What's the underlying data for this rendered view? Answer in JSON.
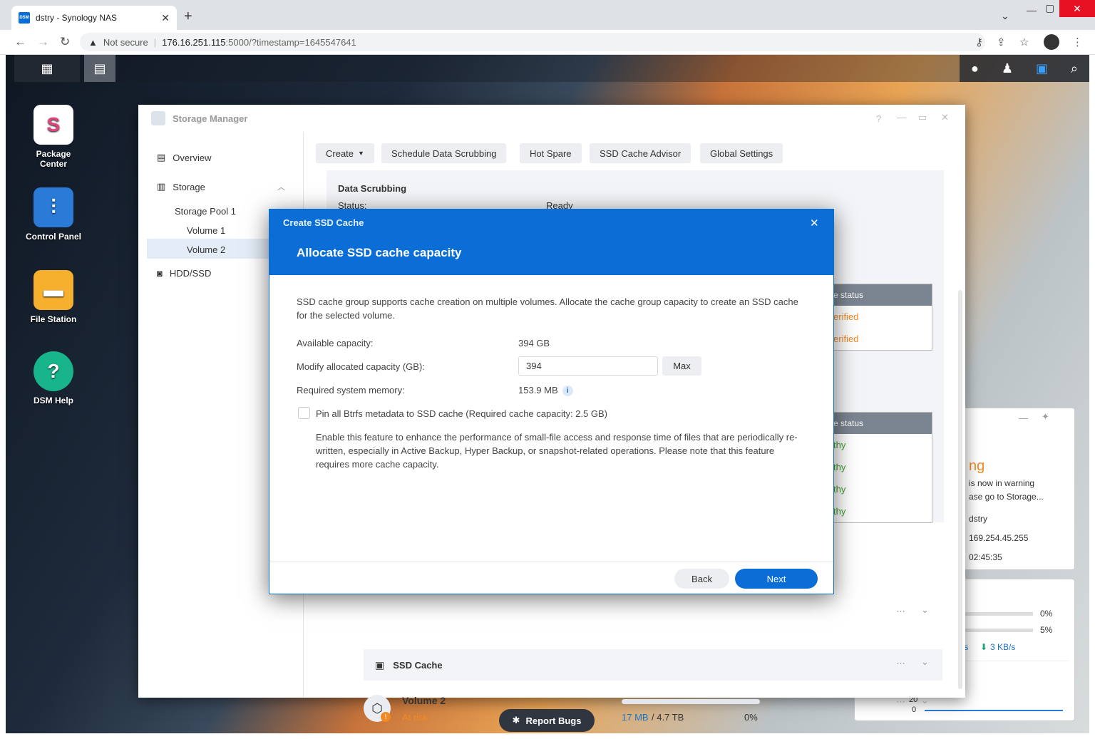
{
  "browser": {
    "tab_title": "dstry - Synology NAS",
    "favicon_text": "DSM",
    "new_tab": "+",
    "security": "Not secure",
    "url_host": "176.16.251.115",
    "url_rest": ":5000/?timestamp=1645547641"
  },
  "desktop": {
    "icons": [
      {
        "label": "Package Center",
        "icon": "package-center-icon"
      },
      {
        "label": "Control Panel",
        "icon": "control-panel-icon"
      },
      {
        "label": "File Station",
        "icon": "file-station-icon"
      },
      {
        "label": "DSM Help",
        "icon": "help-icon"
      }
    ],
    "report_bugs": "Report Bugs"
  },
  "storage_manager": {
    "title": "Storage Manager",
    "sidebar": {
      "overview": "Overview",
      "storage": "Storage",
      "storage_pool_1": "Storage Pool 1",
      "volume_1": "Volume 1",
      "volume_2": "Volume 2",
      "hdd_ssd": "HDD/SSD"
    },
    "toolbar": {
      "create": "Create",
      "schedule": "Schedule Data Scrubbing",
      "hot_spare": "Hot Spare",
      "ssd_advisor": "SSD Cache Advisor",
      "global_settings": "Global Settings"
    },
    "data_scrubbing": {
      "title": "Data Scrubbing",
      "status_label": "Status:",
      "status_value": "Ready"
    },
    "status_table_1": {
      "header": "e status",
      "rows": [
        "erified",
        "erified"
      ]
    },
    "status_table_2": {
      "header": "e status",
      "rows": [
        "thy",
        "thy",
        "thy",
        "thy"
      ]
    },
    "ssd_cache_row": "SSD Cache",
    "volume2_row": {
      "name": "Volume 2",
      "status": "At risk",
      "used": "17 MB",
      "total": "/ 4.7 TB",
      "percent": "0%"
    }
  },
  "widgets": {
    "notif": {
      "title_frag": "ng",
      "line1": "is now in warning",
      "line2": "ase go to Storage...",
      "host": "dstry",
      "ip": "169.254.45.255",
      "time": "02:45:35"
    },
    "monitor": {
      "cpu_pct": "0%",
      "ram_pct": "5%",
      "up": "/s",
      "down": "3 KB/s",
      "y20": "20",
      "y0": "0"
    }
  },
  "dialog": {
    "window_title": "Create SSD Cache",
    "heading": "Allocate SSD cache capacity",
    "description": "SSD cache group supports cache creation on multiple volumes. Allocate the cache group capacity to create an SSD cache for the selected volume.",
    "available_label": "Available capacity:",
    "available_value": "394 GB",
    "modify_label": "Modify allocated capacity (GB):",
    "modify_value": "394",
    "max_button": "Max",
    "memory_label": "Required system memory:",
    "memory_value": "153.9 MB",
    "pin_label": "Pin all Btrfs metadata to SSD cache (Required cache capacity: 2.5 GB)",
    "pin_checked": false,
    "pin_description": "Enable this feature to enhance the performance of small-file access and response time of files that are periodically re-written, especially in Active Backup, Hyper Backup, or snapshot-related operations. Please note that this feature requires more cache capacity.",
    "back_button": "Back",
    "next_button": "Next"
  },
  "colors": {
    "accent": "#0a6ed6",
    "warning": "#f08a24",
    "healthy": "#3c9d29",
    "link": "#1a73c8"
  }
}
